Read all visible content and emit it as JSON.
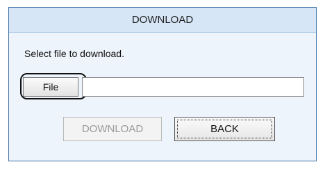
{
  "dialog": {
    "title": "DOWNLOAD",
    "prompt": "Select file to download.",
    "file_button_label": "File",
    "file_path_value": "",
    "download_button_label": "DOWNLOAD",
    "back_button_label": "BACK"
  },
  "colors": {
    "titlebar_bg": "#d6e6f7",
    "body_bg": "#eef4fb",
    "window_border": "#3b6ea5",
    "disabled_text": "#9a9a9a"
  }
}
